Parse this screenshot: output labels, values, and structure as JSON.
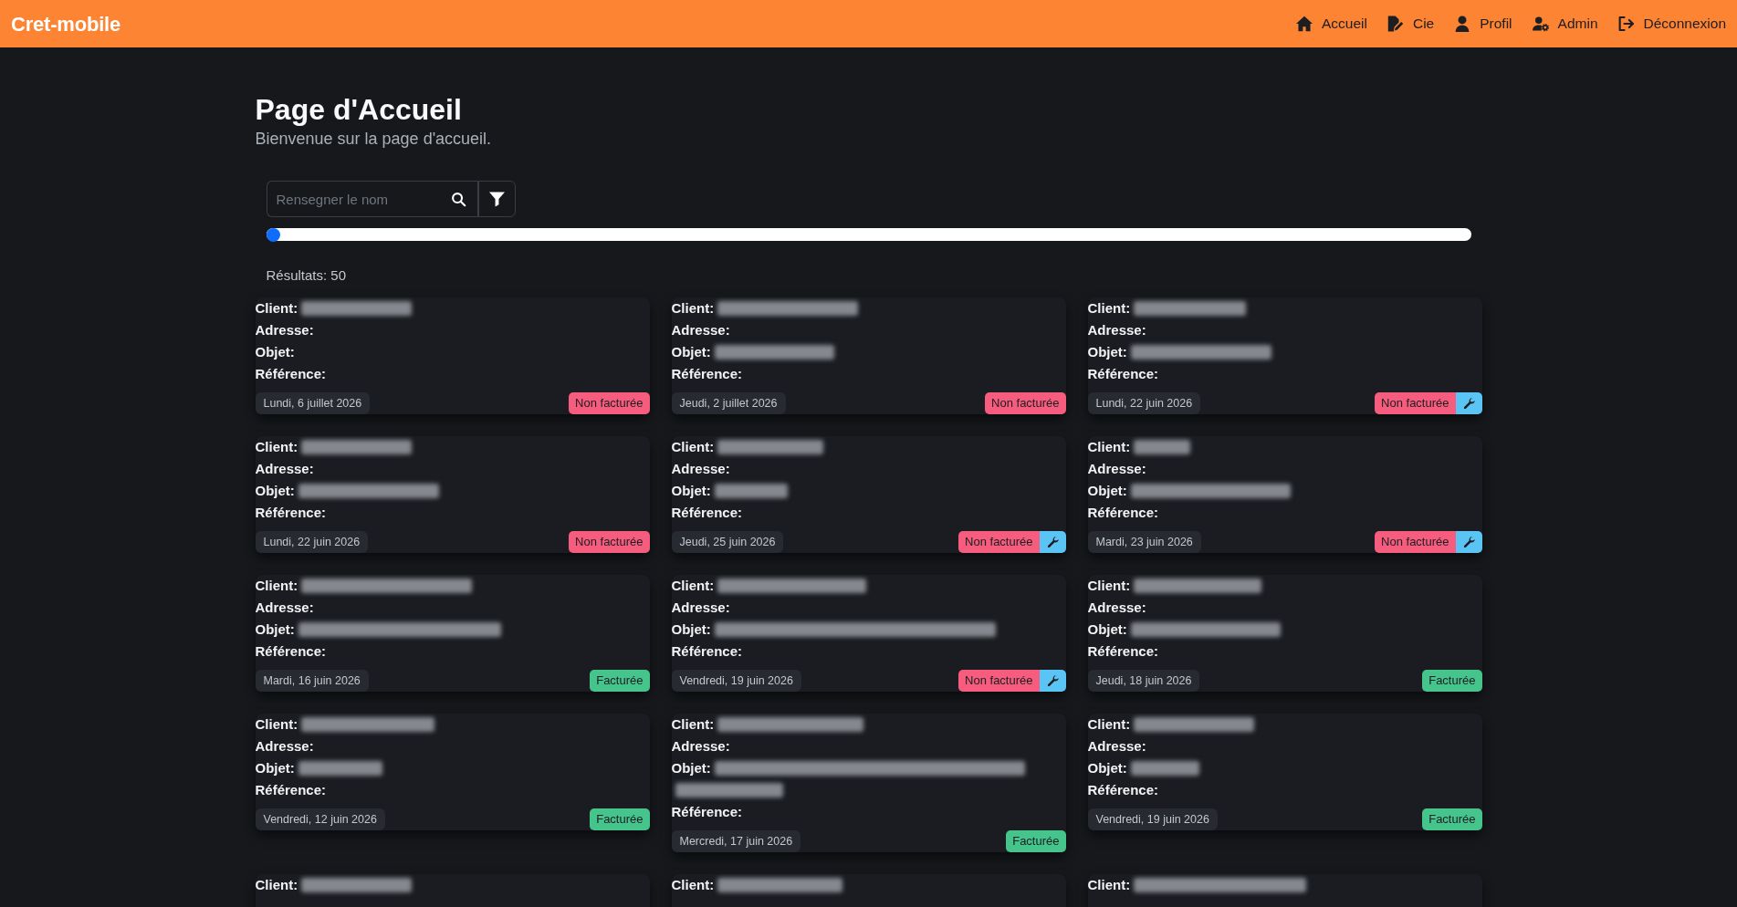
{
  "navbar": {
    "brand": "Cret-mobile",
    "links": [
      {
        "label": "Accueil"
      },
      {
        "label": "Cie"
      },
      {
        "label": "Profil"
      },
      {
        "label": "Admin"
      },
      {
        "label": "Déconnexion"
      }
    ]
  },
  "page": {
    "title": "Page d'Accueil",
    "subtitle": "Bienvenue sur la page d'accueil."
  },
  "search": {
    "placeholder": "Rensegner le nom"
  },
  "slider": {
    "level": 0
  },
  "results": "Résultats: 50",
  "cards": [
    {
      "fields": [
        {
          "label": "Client:",
          "redacted": true
        },
        {
          "label": "Adresse:",
          "redacted": false
        },
        {
          "label": "Objet:",
          "redacted": false
        },
        {
          "label": "Référence:",
          "redacted": false
        }
      ],
      "date": "Lundi, 6 juillet 2026",
      "status": {
        "label": "Non facturée",
        "billed": false
      },
      "action_button": false
    },
    {
      "fields": [
        {
          "label": "Client:",
          "redacted": true
        },
        {
          "label": "Adresse:",
          "redacted": false
        },
        {
          "label": "Objet:",
          "redacted": true
        },
        {
          "label": "Référence:",
          "redacted": false
        }
      ],
      "date": "Jeudi, 2 juillet 2026",
      "status": {
        "label": "Non facturée",
        "billed": false
      },
      "action_button": false
    },
    {
      "fields": [
        {
          "label": "Client:",
          "redacted": true
        },
        {
          "label": "Adresse:",
          "redacted": false
        },
        {
          "label": "Objet:",
          "redacted": true
        },
        {
          "label": "Référence:",
          "redacted": false
        }
      ],
      "date": "Lundi, 22 juin 2026",
      "status": {
        "label": "Non facturée",
        "billed": false
      },
      "action_button": true
    },
    {
      "fields": [
        {
          "label": "Client:",
          "redacted": true
        },
        {
          "label": "Adresse:",
          "redacted": false
        },
        {
          "label": "Objet:",
          "redacted": true
        },
        {
          "label": "Référence:",
          "redacted": false
        }
      ],
      "date": "Lundi, 22 juin 2026",
      "status": {
        "label": "Non facturée",
        "billed": false
      },
      "action_button": false
    },
    {
      "fields": [
        {
          "label": "Client:",
          "redacted": true
        },
        {
          "label": "Adresse:",
          "redacted": false
        },
        {
          "label": "Objet:",
          "redacted": true
        },
        {
          "label": "Référence:",
          "redacted": false
        }
      ],
      "date": "Jeudi, 25 juin 2026",
      "status": {
        "label": "Non facturée",
        "billed": false
      },
      "action_button": true
    },
    {
      "fields": [
        {
          "label": "Client:",
          "redacted": true
        },
        {
          "label": "Adresse:",
          "redacted": false
        },
        {
          "label": "Objet:",
          "redacted": true
        },
        {
          "label": "Référence:",
          "redacted": false
        }
      ],
      "date": "Mardi, 23 juin 2026",
      "status": {
        "label": "Non facturée",
        "billed": false
      },
      "action_button": true
    },
    {
      "fields": [
        {
          "label": "Client:",
          "redacted": true
        },
        {
          "label": "Adresse:",
          "redacted": false
        },
        {
          "label": "Objet:",
          "redacted": true
        },
        {
          "label": "Référence:",
          "redacted": false
        }
      ],
      "date": "Mardi, 16 juin 2026",
      "status": {
        "label": "Facturée",
        "billed": true
      },
      "action_button": false
    },
    {
      "fields": [
        {
          "label": "Client:",
          "redacted": true
        },
        {
          "label": "Adresse:",
          "redacted": false
        },
        {
          "label": "Objet:",
          "redacted": true
        },
        {
          "label": "Référence:",
          "redacted": false
        }
      ],
      "date": "Vendredi, 19 juin 2026",
      "status": {
        "label": "Non facturée",
        "billed": false
      },
      "action_button": true
    },
    {
      "fields": [
        {
          "label": "Client:",
          "redacted": true
        },
        {
          "label": "Adresse:",
          "redacted": false
        },
        {
          "label": "Objet:",
          "redacted": true
        },
        {
          "label": "Référence:",
          "redacted": false
        }
      ],
      "date": "Jeudi, 18 juin 2026",
      "status": {
        "label": "Facturée",
        "billed": true
      },
      "action_button": false
    },
    {
      "fields": [
        {
          "label": "Client:",
          "redacted": true
        },
        {
          "label": "Adresse:",
          "redacted": false
        },
        {
          "label": "Objet:",
          "redacted": true
        },
        {
          "label": "Référence:",
          "redacted": false
        }
      ],
      "date": "Vendredi, 12 juin 2026",
      "status": {
        "label": "Facturée",
        "billed": true
      },
      "action_button": false
    },
    {
      "fields": [
        {
          "label": "Client:",
          "redacted": true
        },
        {
          "label": "Adresse:",
          "redacted": false
        },
        {
          "label": "Objet:",
          "redacted": true
        },
        {
          "label": "Référence:",
          "redacted": false
        }
      ],
      "date": "Mercredi, 17 juin 2026",
      "status": {
        "label": "Facturée",
        "billed": true
      },
      "action_button": false
    },
    {
      "fields": [
        {
          "label": "Client:",
          "redacted": true
        },
        {
          "label": "Adresse:",
          "redacted": false
        },
        {
          "label": "Objet:",
          "redacted": true
        },
        {
          "label": "Référence:",
          "redacted": false
        }
      ],
      "date": "Vendredi, 19 juin 2026",
      "status": {
        "label": "Facturée",
        "billed": true
      },
      "action_button": false
    },
    {
      "fields": [
        {
          "label": "Client:",
          "redacted": true
        }
      ]
    },
    {
      "fields": [
        {
          "label": "Client:",
          "redacted": true
        }
      ]
    },
    {
      "fields": [
        {
          "label": "Client:",
          "redacted": true
        }
      ]
    }
  ]
}
